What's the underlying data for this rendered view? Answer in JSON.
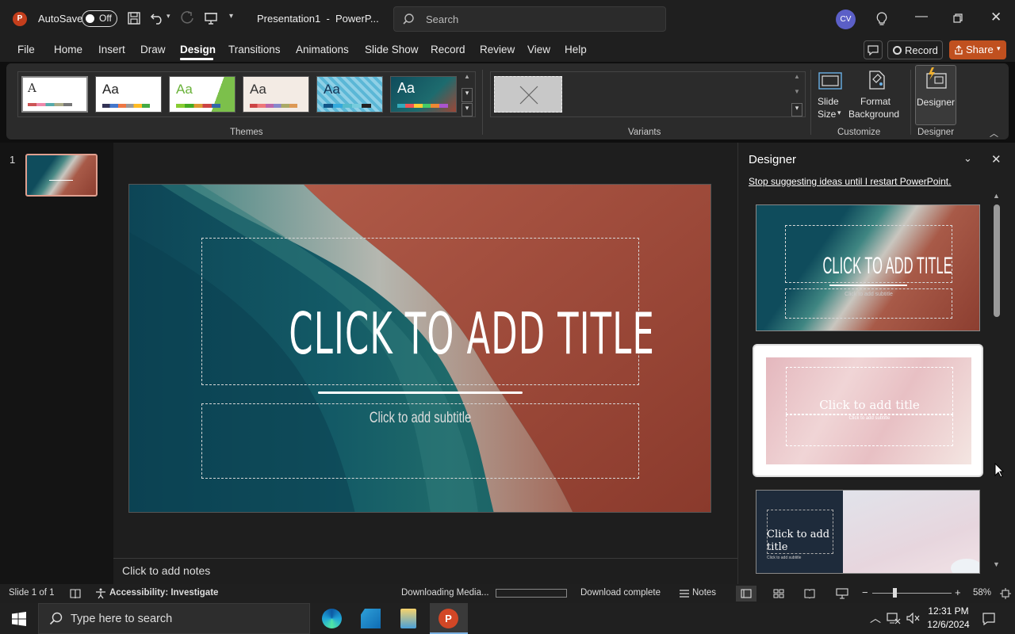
{
  "titlebar": {
    "autosave_label": "AutoSave",
    "autosave_state": "Off",
    "doc_title": "Presentation1  -  PowerP...",
    "search_placeholder": "Search",
    "avatar_initials": "CV"
  },
  "menu": {
    "items": [
      "File",
      "Home",
      "Insert",
      "Draw",
      "Design",
      "Transitions",
      "Animations",
      "Slide Show",
      "Record",
      "Review",
      "View",
      "Help"
    ],
    "active": "Design",
    "record_label": "Record",
    "share_label": "Share"
  },
  "ribbon": {
    "themes_label": "Themes",
    "variants_label": "Variants",
    "customize_label": "Customize",
    "designer_group_label": "Designer",
    "slide_size_label_1": "Slide",
    "slide_size_label_2": "Size",
    "format_bg_label_1": "Format",
    "format_bg_label_2": "Background",
    "designer_button_label": "Designer",
    "theme_sample_text": "Aa",
    "theme_sample_text_first": "A"
  },
  "thumbnails": {
    "slide_number": "1"
  },
  "slide": {
    "title_placeholder": "CLICK TO ADD TITLE",
    "subtitle_placeholder": "Click to add subtitle"
  },
  "notes": {
    "placeholder": "Click to add notes"
  },
  "designer": {
    "title": "Designer",
    "stop_link": "Stop suggesting ideas until I restart PowerPoint.",
    "idea1_title": "CLICK TO ADD TITLE",
    "idea1_subtitle": "Click to add subtitle",
    "idea2_title": "Click to add title",
    "idea2_subtitle": "Click to add subtitle",
    "idea3_title": "Click to add title",
    "idea3_subtitle": "Click to add subtitle"
  },
  "status": {
    "slide_info": "Slide 1 of 1",
    "accessibility": "Accessibility: Investigate",
    "downloading": "Downloading Media...",
    "download_complete": "Download complete",
    "notes_label": "Notes",
    "zoom": "58%"
  },
  "taskbar": {
    "search_placeholder": "Type here to search",
    "time": "12:31 PM",
    "date": "12/6/2024"
  },
  "colors": {
    "accent_orange": "#c43e1c",
    "share_orange": "#c0501f",
    "slide_teal": "#0f4c5c",
    "slide_red": "#9c4636"
  }
}
